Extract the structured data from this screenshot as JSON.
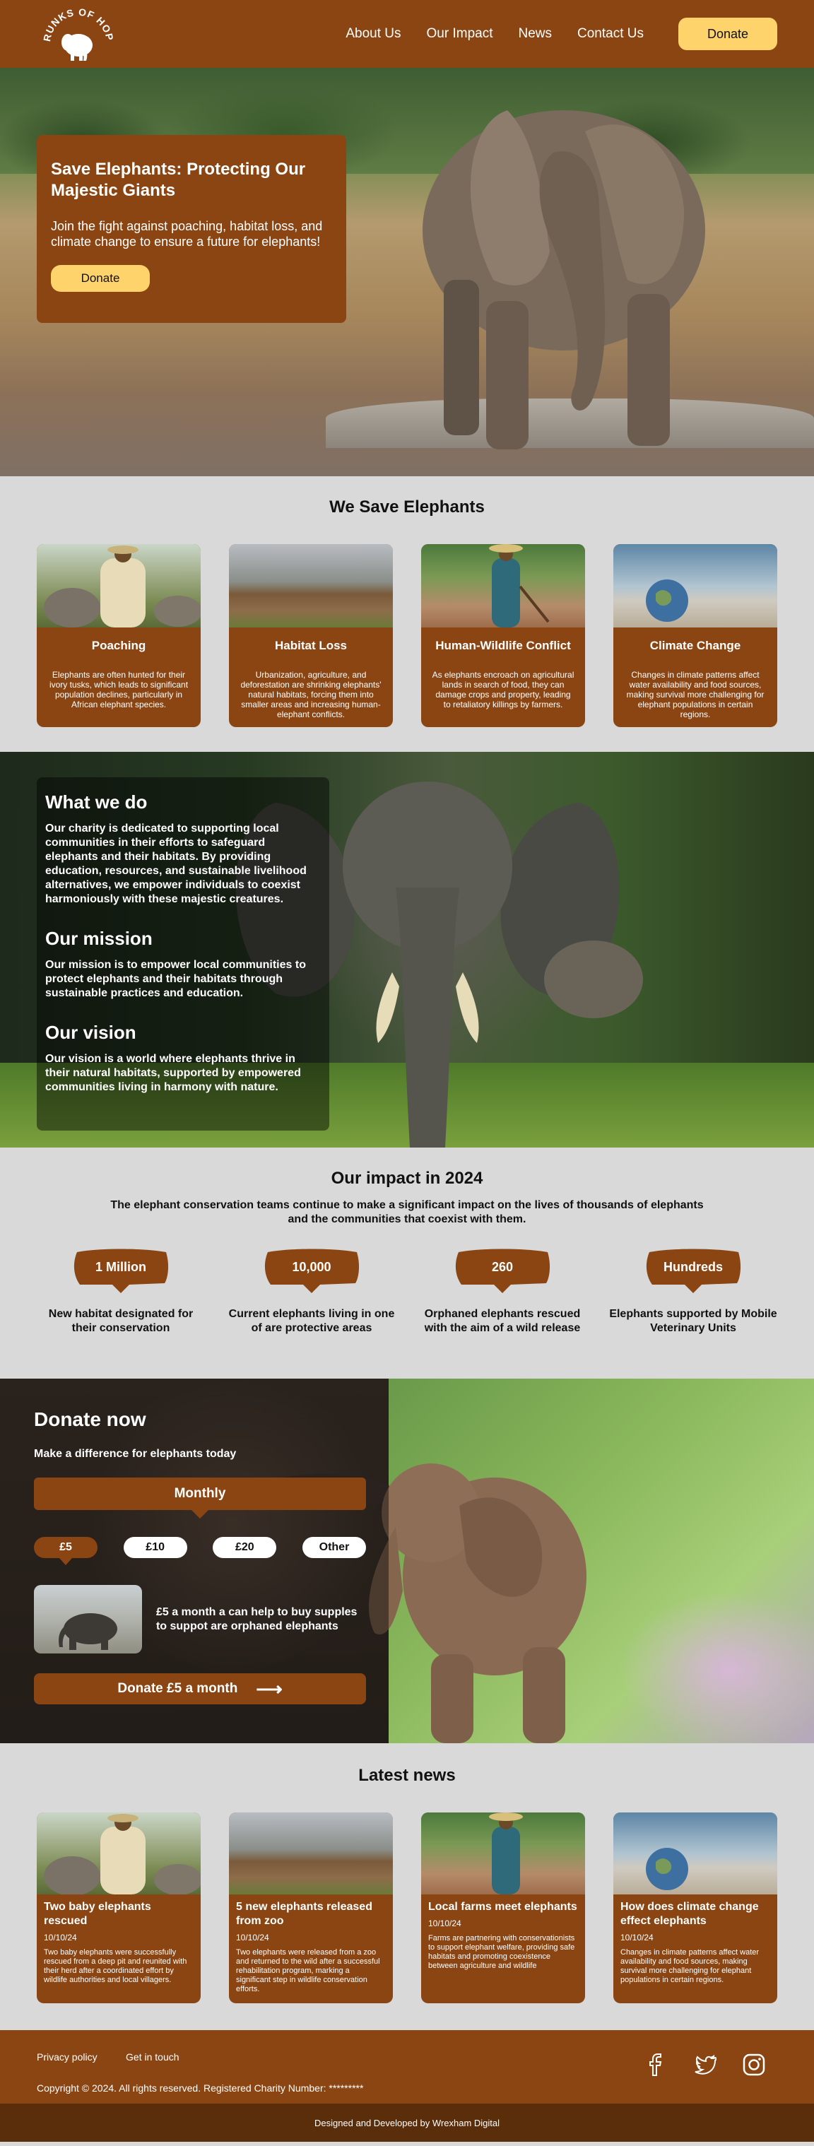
{
  "header": {
    "logo_text": "TRUNKS OF HOPE",
    "nav": [
      "About Us",
      "Our Impact",
      "News",
      "Contact Us"
    ],
    "donate_label": "Donate"
  },
  "hero": {
    "title": "Save Elephants: Protecting Our Majestic Giants",
    "text": "Join the fight against poaching, habitat loss, and climate change to ensure a future for elephants!",
    "button": "Donate"
  },
  "save": {
    "title": "We Save Elephants",
    "cards": [
      {
        "title": "Poaching",
        "text": "Elephants are often hunted for their ivory tusks, which leads to significant population declines, particularly in African elephant species."
      },
      {
        "title": "Habitat Loss",
        "text": "Urbanization, agriculture, and deforestation are shrinking elephants' natural habitats, forcing them into smaller areas and increasing human-elephant conflicts."
      },
      {
        "title": "Human-Wildlife Conflict",
        "text": "As elephants encroach on agricultural lands in search of food, they can damage crops and property, leading to retaliatory killings by farmers."
      },
      {
        "title": "Climate Change",
        "text": "Changes in climate patterns affect water availability and food sources, making survival more challenging for elephant populations in certain regions."
      }
    ]
  },
  "what": {
    "h1": "What we do",
    "p1": "Our charity is dedicated to supporting local communities in their efforts to safeguard elephants and their habitats. By providing education, resources, and sustainable livelihood alternatives, we empower individuals to coexist harmoniously with these majestic creatures.",
    "h2": "Our mission",
    "p2": "Our mission is to empower local communities to protect elephants and their habitats through sustainable practices and education.",
    "h3": "Our vision",
    "p3": "Our vision is a world where elephants thrive in their natural habitats, supported by empowered communities living in harmony with nature."
  },
  "impact": {
    "title": "Our impact in 2024",
    "lead": "The elephant conservation teams continue to make a significant impact on the lives of thousands of elephants and the communities that coexist with them.",
    "stats": [
      {
        "value": "1 Million",
        "label": "New habitat designated for their conservation"
      },
      {
        "value": "10,000",
        "label": "Current elephants living in one of are protective areas"
      },
      {
        "value": "260",
        "label": "Orphaned elephants rescued with the aim of a wild release"
      },
      {
        "value": "Hundreds",
        "label": "Elephants supported by Mobile Veterinary Units"
      }
    ]
  },
  "donate": {
    "title": "Donate now",
    "subtitle": "Make a difference for elephants today",
    "frequency": "Monthly",
    "amounts": [
      "£5",
      "£10",
      "£20",
      "Other"
    ],
    "impact_text": "£5  a  month  a can help to buy supples to suppot are orphaned elephants",
    "cta": "Donate £5 a month",
    "cta_arrow": "⟶"
  },
  "news": {
    "title": "Latest news",
    "items": [
      {
        "title": "Two baby elephants rescued",
        "date": "10/10/24",
        "text": "Two baby elephants were successfully rescued from a deep pit and reunited with their herd after a coordinated effort by wildlife authorities and local villagers."
      },
      {
        "title": "5 new elephants released from zoo",
        "date": "10/10/24",
        "text": "Two elephants were released from a zoo and returned to the wild after a successful rehabilitation program, marking a significant step in wildlife conservation efforts."
      },
      {
        "title": "Local farms meet elephants",
        "date": "10/10/24",
        "text": "Farms are partnering with conservationists to support elephant welfare, providing safe habitats and promoting coexistence between agriculture and wildlife"
      },
      {
        "title": "How does climate change effect elephants",
        "date": "10/10/24",
        "text": "Changes in climate patterns affect water availability and food sources, making survival more challenging for elephant populations in certain regions."
      }
    ]
  },
  "footer": {
    "links": [
      "Privacy policy",
      "Get in touch"
    ],
    "copyright": "Copyright © 2024. All rights reserved. Registered Charity Number: *********",
    "credit": "Designed and Developed by Wrexham Digital"
  },
  "colors": {
    "brand": "#8b4513",
    "accent": "#ffd36b",
    "page": "#d9d9d9"
  }
}
